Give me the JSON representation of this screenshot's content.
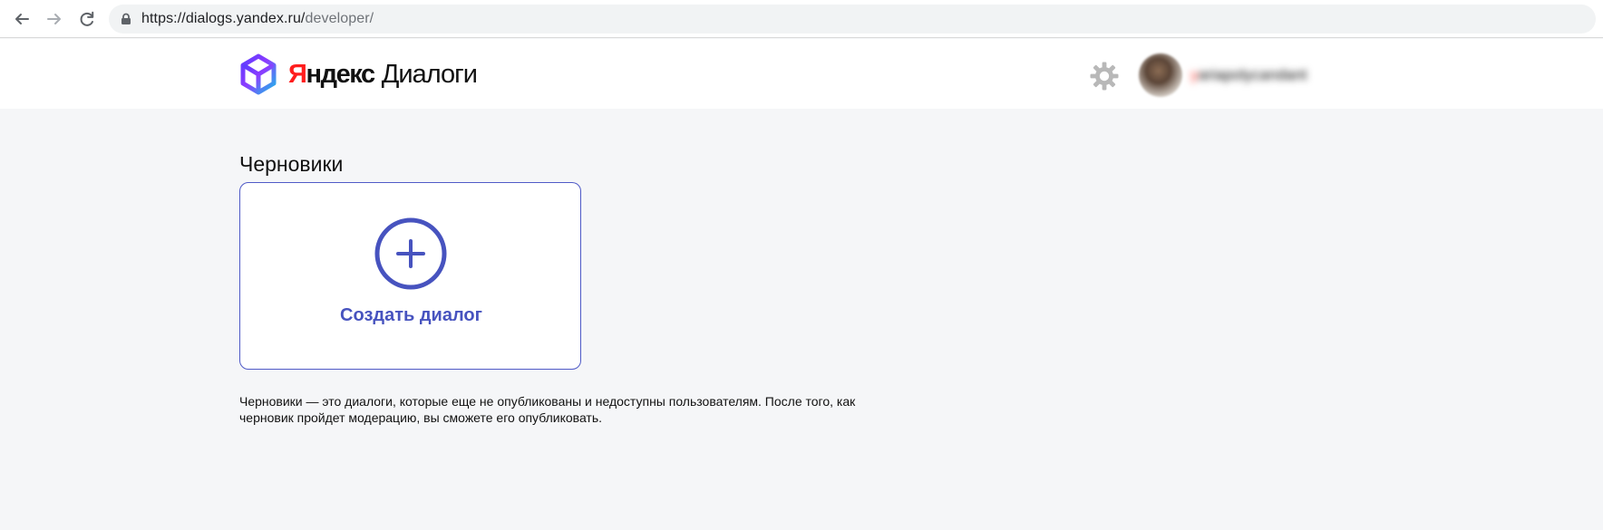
{
  "browser": {
    "url_host": "https://dialogs.yandex.ru/",
    "url_path": "developer/"
  },
  "header": {
    "brand_yandex_first": "Я",
    "brand_yandex_rest": "ндекс",
    "brand_dialogs": "Диалоги",
    "username_first": "у",
    "username_rest": "ariapolycandant"
  },
  "main": {
    "title": "Черновики",
    "create_dialog_label": "Создать диалог",
    "description": "Черновики — это диалоги, которые еще не опубликованы и недоступны пользователям. После того, как черновик пройдет модерацию, вы сможете его опубликовать."
  },
  "colors": {
    "accent": "#4753bf",
    "brand_red": "#ff1d1d",
    "page_background": "#f5f6f8"
  },
  "icons": {
    "back": "arrow-left-icon",
    "forward": "arrow-right-icon",
    "reload": "reload-icon",
    "lock": "lock-icon",
    "settings": "gear-icon",
    "create": "plus-circle-icon",
    "logo": "cube-logo-icon"
  }
}
